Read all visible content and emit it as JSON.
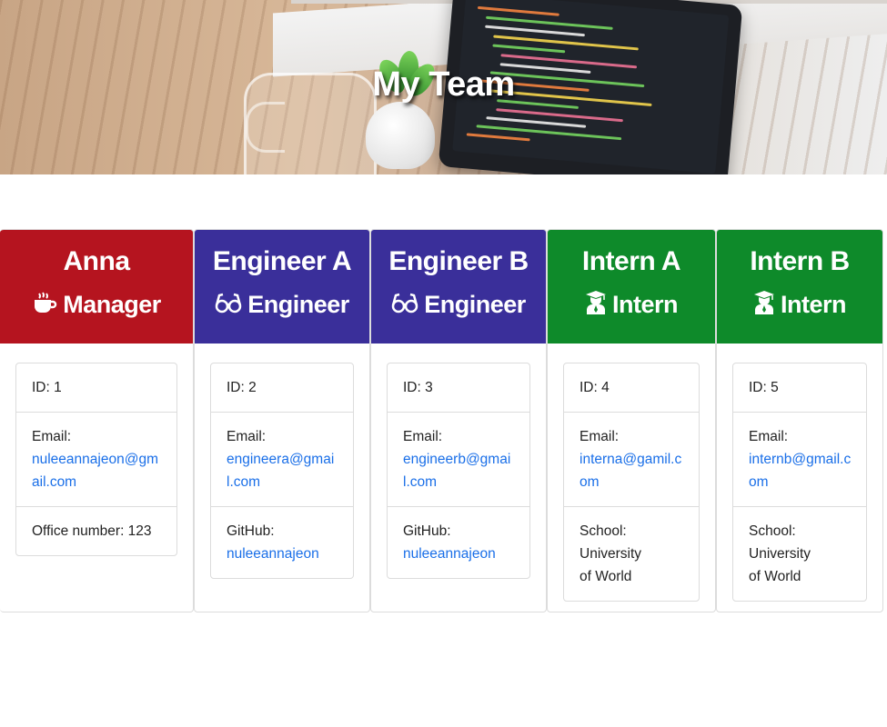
{
  "header": {
    "title": "My Team"
  },
  "colors": {
    "manager": "#b5141f",
    "engineer": "#3a2f9a",
    "intern": "#0e8a2a",
    "link": "#1a6fe8"
  },
  "members": [
    {
      "name": "Anna",
      "role": "Manager",
      "role_icon": "coffee-cup-icon",
      "id_text": "ID: 1",
      "email_label": "Email:",
      "email": "nuleeannajeon@gmail.com",
      "extra_label": "Office number: 123",
      "extra_value": ""
    },
    {
      "name": "Engineer A",
      "role": "Engineer",
      "role_icon": "glasses-icon",
      "id_text": "ID: 2",
      "email_label": "Email:",
      "email": "engineera@gmail.com",
      "extra_label": "GitHub:",
      "extra_value": "nuleeannajeon"
    },
    {
      "name": "Engineer B",
      "role": "Engineer",
      "role_icon": "glasses-icon",
      "id_text": "ID: 3",
      "email_label": "Email:",
      "email": "engineerb@gmail.com",
      "extra_label": "GitHub:",
      "extra_value": "nuleeannajeon"
    },
    {
      "name": "Intern A",
      "role": "Intern",
      "role_icon": "graduate-icon",
      "id_text": "ID: 4",
      "email_label": "Email:",
      "email": "interna@gamil.com",
      "extra_label": "School:",
      "extra_value": "University of World"
    },
    {
      "name": "Intern B",
      "role": "Intern",
      "role_icon": "graduate-icon",
      "id_text": "ID: 5",
      "email_label": "Email:",
      "email": "internb@gmail.com",
      "extra_label": "School:",
      "extra_value": "University of World"
    }
  ]
}
